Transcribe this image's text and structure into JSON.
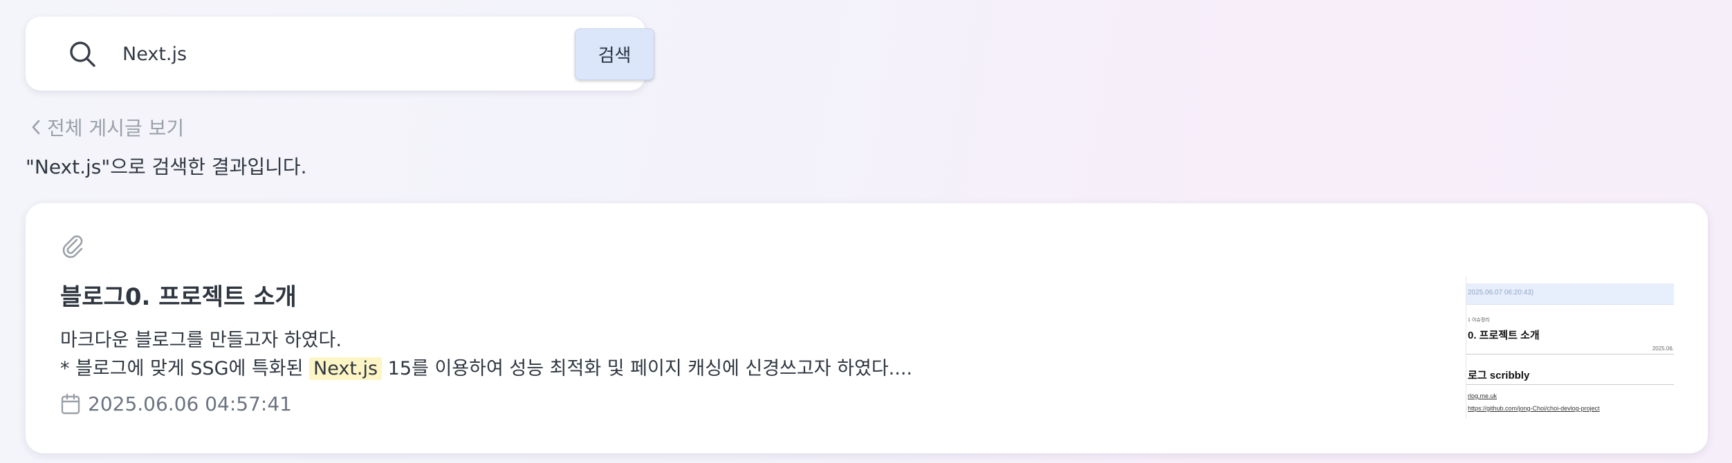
{
  "search": {
    "value": "Next.js",
    "button_label": "검색",
    "icon": "search-icon"
  },
  "nav": {
    "back_label": "전체 게시글 보기",
    "back_icon": "chevron-left-icon"
  },
  "results": {
    "summary": "\"Next.js\"으로 검색한 결과입니다."
  },
  "post": {
    "category_icon": "paperclip-icon",
    "title": "블로그0. 프로젝트 소개",
    "excerpt_line1": "마크다운 블로그를 만들고자 하였다.",
    "excerpt_line2_before": "* 블로그에 맞게 SSG에 특화된 ",
    "excerpt_highlight": "Next.js",
    "excerpt_line2_after": " 15를 이용하여 성능 최적화 및 페이지 캐싱에 신경쓰고자 하였다....",
    "date_icon": "calendar-icon",
    "date": "2025.06.06 04:57:41",
    "highlight_color": "#fdf5c5",
    "thumbnail": {
      "bar_text": "2025.06.07 06:20:43)",
      "category": "1 이슈정리",
      "title": "0. 프로젝트 소개",
      "date_partial": "2025.06.",
      "heading": "로그 scribbly",
      "link1": "rlog.me.uk",
      "link2": "https://github.com/jong-Choi/choi-devlog-project"
    }
  }
}
